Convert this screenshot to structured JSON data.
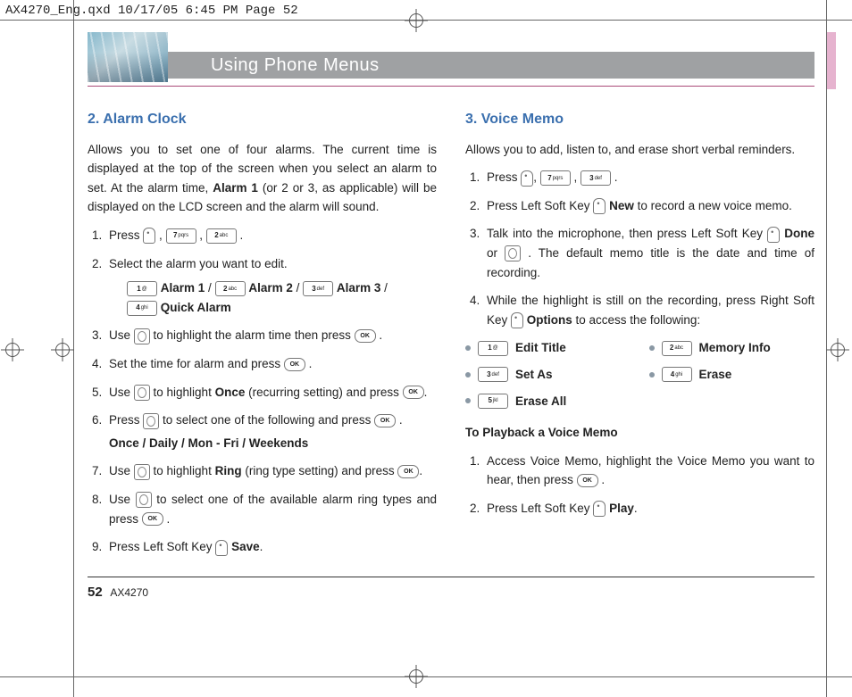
{
  "slug": "AX4270_Eng.qxd  10/17/05  6:45 PM  Page 52",
  "banner": "Using Phone Menus",
  "footer": {
    "page": "52",
    "model": "AX4270"
  },
  "left": {
    "heading": "2. Alarm Clock",
    "intro_a": "Allows you to set one of four alarms. The current time is displayed at the top of the screen when you select an alarm to set. At the alarm time, ",
    "intro_bold1": "Alarm 1",
    "intro_b": " (or 2 or 3, as applicable) will be displayed on the LCD screen and the alarm will sound.",
    "s1": "Press ",
    "s2": "Select the alarm you want to edit.",
    "s2_a1": "Alarm 1",
    "s2_a2": "Alarm 2",
    "s2_a3": "Alarm 3",
    "s2_qa": "Quick Alarm",
    "s3a": "Use ",
    "s3b": " to highlight the alarm time then press ",
    "s4": "Set the time for alarm and press ",
    "s5a": "Use ",
    "s5b": " to highlight ",
    "s5_once": "Once",
    "s5c": " (recurring setting) and press ",
    "s6a": "Press ",
    "s6b": " to select one of the following and press ",
    "s6_opts": "Once / Daily / Mon - Fri / Weekends",
    "s7a": "Use ",
    "s7b": " to highlight ",
    "s7_ring": "Ring",
    "s7c": " (ring type setting) and press ",
    "s8a": "Use ",
    "s8b": " to select one of the available alarm ring types and press ",
    "s9a": "Press Left Soft Key ",
    "s9_save": "Save"
  },
  "right": {
    "heading": "3. Voice Memo",
    "intro": "Allows you to add, listen to, and erase short verbal reminders.",
    "s1": "Press ",
    "s2a": "Press Left Soft Key ",
    "s2_new": "New",
    "s2b": " to record a new voice memo.",
    "s3a": "Talk into the microphone, then press Left Soft Key ",
    "s3_done": "Done",
    "s3b": " or ",
    "s3c": ". The default memo title is the date and time of recording.",
    "s4a": "While the highlight is still on the recording, press Right Soft Key ",
    "s4_opts": "Options",
    "s4b": " to access the following:",
    "opt1": "Edit Title",
    "opt2": "Memory Info",
    "opt3": "Set As",
    "opt4": "Erase",
    "opt5": "Erase All",
    "sub_h": "To Playback a Voice Memo",
    "p1a": "Access Voice Memo, highlight the Voice Memo you want to hear, then press ",
    "p2a": "Press Left Soft Key ",
    "p2_play": "Play"
  },
  "keys": {
    "k1": "1",
    "k1s": "@",
    "k2": "2",
    "k2s": "abc",
    "k3": "3",
    "k3s": "def",
    "k4": "4",
    "k4s": "ghi",
    "k5": "5",
    "k5s": "jkl",
    "k7": "7",
    "k7s": "pqrs",
    "ok": "OK"
  }
}
